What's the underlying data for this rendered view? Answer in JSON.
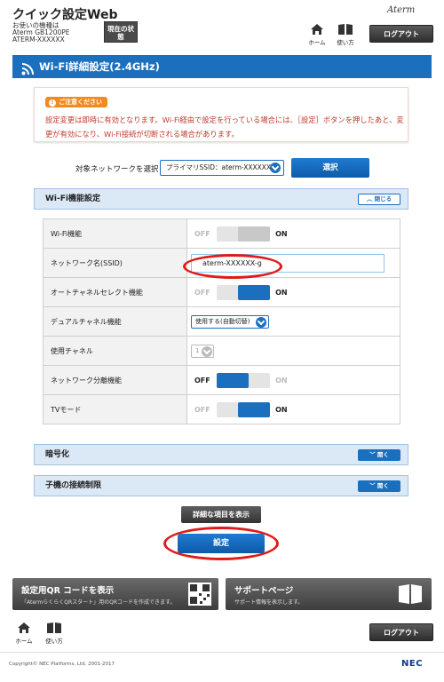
{
  "header": {
    "app_title": "クイック設定Web",
    "model_label": "お使いの機種は",
    "model_name": "Aterm GB1200PE",
    "model_id": "ATERM-XXXXXX",
    "status_button": "現在の状態",
    "brand": "Aterm",
    "home_label": "ホーム",
    "help_label": "使い方",
    "logout_label": "ログアウト"
  },
  "page_title": "Wi-Fi詳細設定(2.4GHz)",
  "notice": {
    "tag": "ご注意ください",
    "text": "設定変更は即時に有効となります。Wi-Fi経由で設定を行っている場合には、［設定］ボタンを押したあと、変更が有効になり、Wi-Fi接続が切断される場合があります。"
  },
  "network_select": {
    "label": "対象ネットワークを選択",
    "value": "プライマリSSID：aterm-XXXXXX-g",
    "button": "選択"
  },
  "wifi_section": {
    "title": "Wi-Fi機能設定",
    "close_label": "閉じる",
    "rows": [
      {
        "label": "Wi-Fi機能",
        "off": "OFF",
        "on": "ON"
      },
      {
        "label": "ネットワーク名(SSID)",
        "value": "aterm-XXXXXX-g"
      },
      {
        "label": "オートチャネルセレクト機能",
        "off": "OFF",
        "on": "ON"
      },
      {
        "label": "デュアルチャネル機能",
        "value": "使用する(自動切替)"
      },
      {
        "label": "使用チャネル",
        "value": "1"
      },
      {
        "label": "ネットワーク分離機能",
        "off": "OFF",
        "on": "ON"
      },
      {
        "label": "TVモード",
        "off": "OFF",
        "on": "ON"
      }
    ]
  },
  "encryption_section": {
    "title": "暗号化",
    "open_label": "開く"
  },
  "client_limit_section": {
    "title": "子機の接続制限",
    "open_label": "開く"
  },
  "detail_button": "詳細な項目を表示",
  "submit_button": "設定",
  "cards": {
    "qr_title": "設定用QR コードを表示",
    "qr_desc": "「AtermらくらくQRスタート」用のQRコードを作成できます。",
    "support_title": "サポートページ",
    "support_desc": "サポート情報を表示します。"
  },
  "footer": {
    "home_label": "ホーム",
    "help_label": "使い方",
    "logout_label": "ログアウト",
    "copyright": "Copyright© NEC Platforms, Ltd. 2001-2017",
    "brand": "NEC"
  },
  "colors": {
    "accent": "#1b6fbf",
    "notice_text": "#c0392b",
    "notice_tag": "#f38a1e",
    "highlight": "#e01b1b"
  }
}
